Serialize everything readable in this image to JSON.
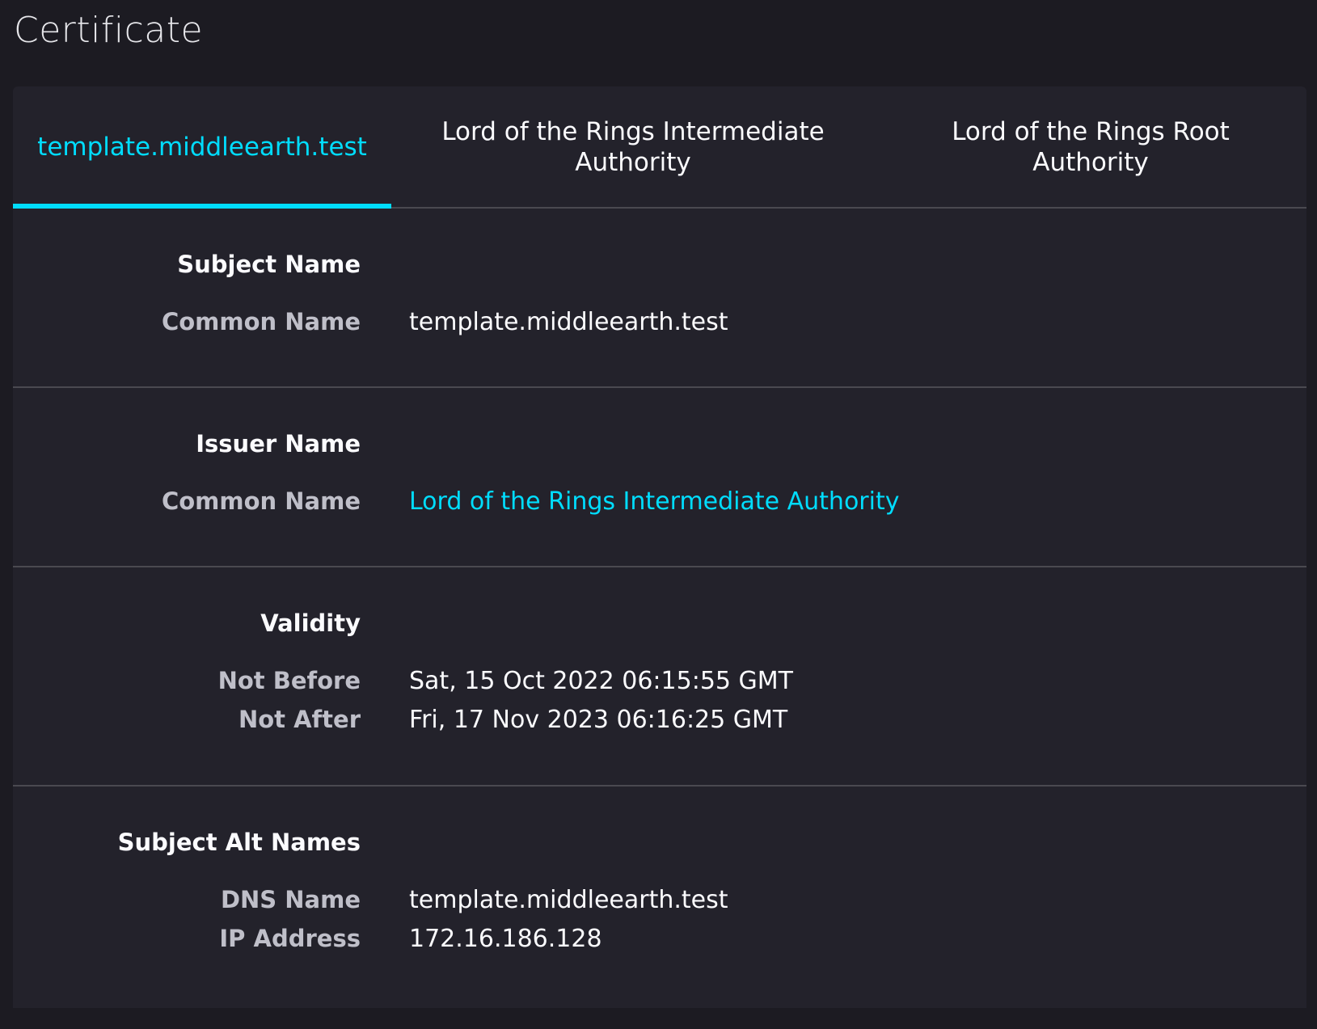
{
  "page": {
    "title": "Certificate"
  },
  "tabs": [
    {
      "label": "template.middleearth.test",
      "active": true
    },
    {
      "label": "Lord of the Rings Intermediate Authority",
      "active": false
    },
    {
      "label": "Lord of the Rings Root Authority",
      "active": false
    }
  ],
  "subject": {
    "heading": "Subject Name",
    "common_name_label": "Common Name",
    "common_name_value": "template.middleearth.test"
  },
  "issuer": {
    "heading": "Issuer Name",
    "common_name_label": "Common Name",
    "common_name_value": "Lord of the Rings Intermediate Authority"
  },
  "validity": {
    "heading": "Validity",
    "not_before_label": "Not Before",
    "not_before_value": "Sat, 15 Oct 2022 06:15:55 GMT",
    "not_after_label": "Not After",
    "not_after_value": "Fri, 17 Nov 2023 06:16:25 GMT"
  },
  "san": {
    "heading": "Subject Alt Names",
    "dns_label": "DNS Name",
    "dns_value": "template.middleearth.test",
    "ip_label": "IP Address",
    "ip_value": "172.16.186.128"
  },
  "colors": {
    "background": "#1c1b22",
    "card": "#23222b",
    "accent": "#00ddff",
    "divider": "#4a4950",
    "label": "#bfbfc9",
    "text": "#fbfbfe"
  }
}
